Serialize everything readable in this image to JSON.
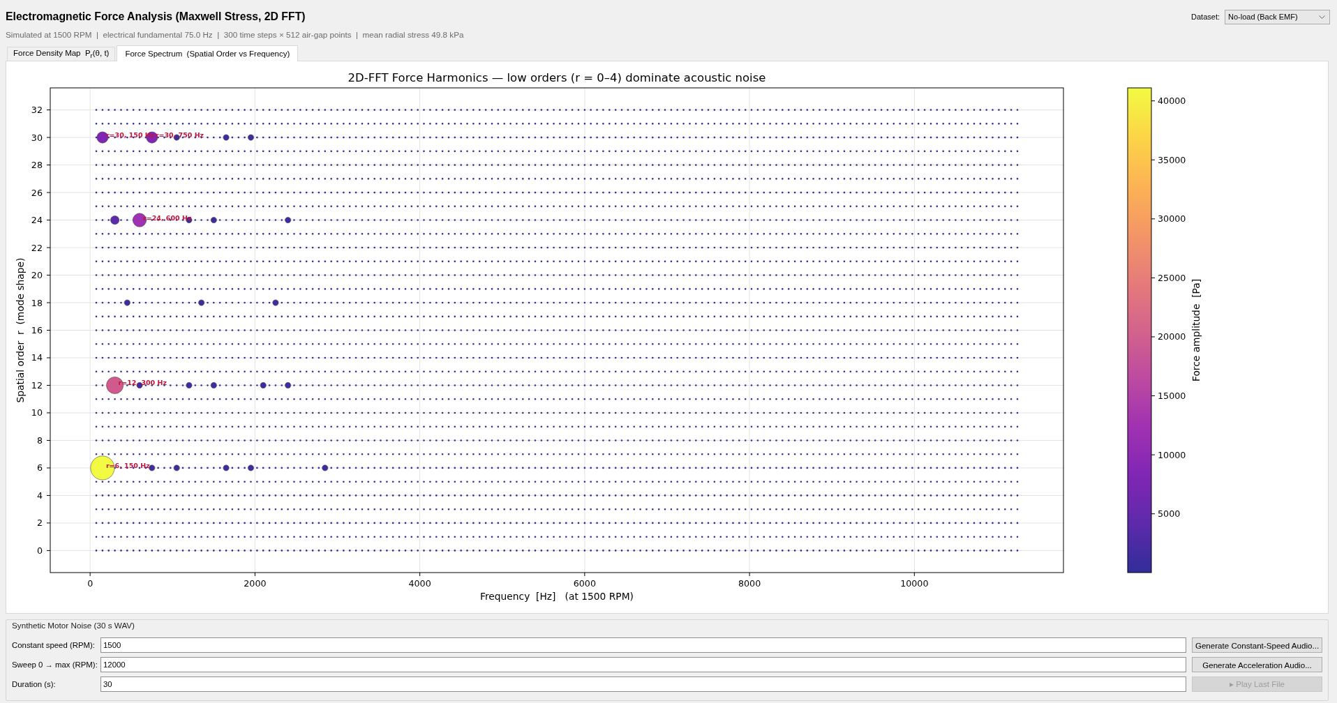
{
  "header": {
    "title": "Electromagnetic Force Analysis (Maxwell Stress, 2D FFT)",
    "subtitle": "Simulated at 1500 RPM  |  electrical fundamental 75.0 Hz  |  300 time steps × 512 air-gap points  |  mean radial stress 49.8 kPa",
    "dataset": {
      "label": "Dataset:",
      "value": "No-load (Back EMF)"
    }
  },
  "tabs": [
    {
      "label": "Force Density Map  P$_{r}$(θ, t)",
      "selected": false
    },
    {
      "label": "Force Spectrum  (Spatial Order vs Frequency)",
      "selected": true
    }
  ],
  "spectrum_panel": {
    "chart_data": {
      "type": "scatter",
      "title": "2D-FFT Force Harmonics — low orders (r = 0–4) dominate acoustic noise",
      "xlabel": "Frequency  [Hz]   (at 1500 RPM)",
      "ylabel": "Spatial order  r  (mode shape)",
      "xlim": [
        -484,
        11809
      ],
      "ylim": [
        -1.6,
        33.6
      ],
      "xticks": [
        0,
        2000,
        4000,
        6000,
        8000,
        10000
      ],
      "yticks": [
        0,
        2,
        4,
        6,
        8,
        10,
        12,
        14,
        16,
        18,
        20,
        22,
        24,
        26,
        28,
        30,
        32
      ],
      "grid": true,
      "series": [
        {
          "color": "#f2fa42",
          "x": [
            150
          ],
          "values": [
            6
          ]
        },
        {
          "color": "#d05a8c",
          "x": [
            300
          ],
          "values": [
            12
          ]
        },
        {
          "color": "#a031b2",
          "x": [
            600
          ],
          "values": [
            24
          ]
        },
        {
          "color": "#8026b5",
          "x": [
            150,
            750
          ],
          "values": [
            30,
            30
          ]
        },
        {
          "color": "#5e2aac",
          "x": [
            300
          ],
          "values": [
            24
          ]
        },
        {
          "color": "#3f2c9f",
          "x": [
            750,
            1050,
            1650,
            1950,
            2850,
            600,
            1200,
            1500,
            2100,
            2400,
            450,
            1350,
            2250,
            1200,
            1500,
            2400,
            1050,
            1650,
            1950
          ],
          "values": [
            6,
            6,
            6,
            6,
            6,
            12,
            12,
            12,
            12,
            12,
            18,
            18,
            18,
            24,
            24,
            24,
            30,
            30,
            30
          ]
        }
      ],
      "annotations": [
        {
          "text": "r=30, 150 Hz",
          "x": 150,
          "y": 30
        },
        {
          "text": "r=30, 750 Hz",
          "x": 750,
          "y": 30
        },
        {
          "text": "r=24, 600 Hz",
          "x": 600,
          "y": 24
        },
        {
          "text": "r=12, 300 Hz",
          "x": 300,
          "y": 12
        },
        {
          "text": "r=6, 150 Hz",
          "x": 150,
          "y": 6
        }
      ]
    },
    "colorbar": {
      "label": "Force amplitude  [Pa]",
      "ticks": [
        "40000",
        "35000",
        "30000",
        "25000",
        "20000",
        "15000",
        "10000",
        "5000"
      ]
    }
  },
  "audio_group": {
    "title": "Synthetic Motor Noise (30 s WAV)",
    "rows": [
      {
        "label": "Constant speed (RPM):",
        "value": "1500",
        "button": {
          "label": "Generate Constant-Speed Audio...",
          "disabled": false
        }
      },
      {
        "label": "Sweep 0 → max (RPM):",
        "value": "12000",
        "button": {
          "label": "Generate Acceleration Audio...",
          "disabled": false
        }
      },
      {
        "label": "Duration (s):",
        "value": "30",
        "button": {
          "label": "▸ Play Last File",
          "disabled": true
        }
      }
    ]
  }
}
